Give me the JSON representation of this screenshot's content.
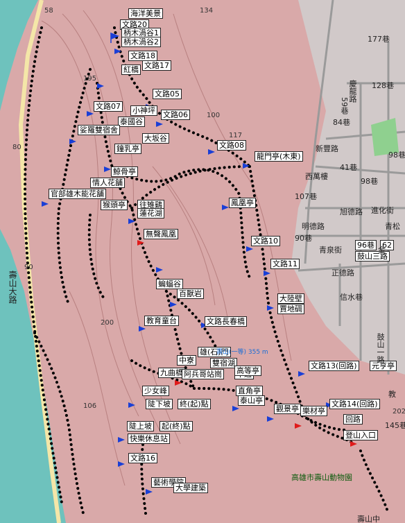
{
  "trail_labels": [
    "海洋美景",
    "文路20",
    "柄木渦谷1",
    "柄木渦谷2",
    "文路18",
    "文路17",
    "紅橋",
    "文路05",
    "文路07",
    "小神坪",
    "泰國谷",
    "文路06",
    "娑羅雙宿舍",
    "大坂谷",
    "鐘乳亭",
    "文路08",
    "龍門亭(木東)",
    "鯨骨亭",
    "情人花舗",
    "官部雄木能花舗",
    "猴頭亭",
    "往雉鷄",
    "蓮花湖",
    "無聲鳳凰",
    "鳳凰亭",
    "文路10",
    "文路11",
    "蝙蝠谷",
    "百獸岩",
    "大陸壁",
    "教育童台",
    "文路長春橋",
    "賈地碉",
    "中寮",
    "雄(石)門",
    "九曲橋",
    "雙宿湖",
    "阿兵哥站崗",
    "不通",
    "直角亭",
    "泰山亭",
    "高等亭",
    "少女峰",
    "陡下坡",
    "終(起)點",
    "觀景亭",
    "樂材亭",
    "文路13(回路)",
    "元亨亭",
    "文路14(回路)",
    "回路",
    "陡上坡",
    "起(終)點",
    "快樂休息站",
    "登山入口",
    "文路16",
    "藝術學院",
    "大學建築"
  ],
  "streets": [
    "96巷",
    "62",
    "鼓山三路",
    "177巷",
    "128巷",
    "慶龍路",
    "59巷",
    "84巷",
    "新豐路",
    "98巷",
    "西萬樓",
    "41巷",
    "107巷",
    "98巷",
    "旭德路",
    "進化街",
    "青松",
    "明德路",
    "90巷",
    "青泉街",
    "正德路",
    "信水巷",
    "鼓山一路",
    "145巷",
    "金",
    "教",
    "壽山大路",
    "壽山中"
  ],
  "contours": [
    "58",
    "134",
    "195",
    "80",
    "100",
    "117",
    "90",
    "200",
    "106",
    "202"
  ],
  "peak_label": "壽山(一等) 355 m",
  "zoo_label": "高雄市壽山動物園",
  "colors": {
    "terrain": "#d9a9a9",
    "sea": "#6ec2bd",
    "trail_dot": "#000000",
    "flag": "#1a3fd6",
    "start_flag": "#e01b1b",
    "city": "#cfcfcf",
    "park": "#8fd08f"
  }
}
